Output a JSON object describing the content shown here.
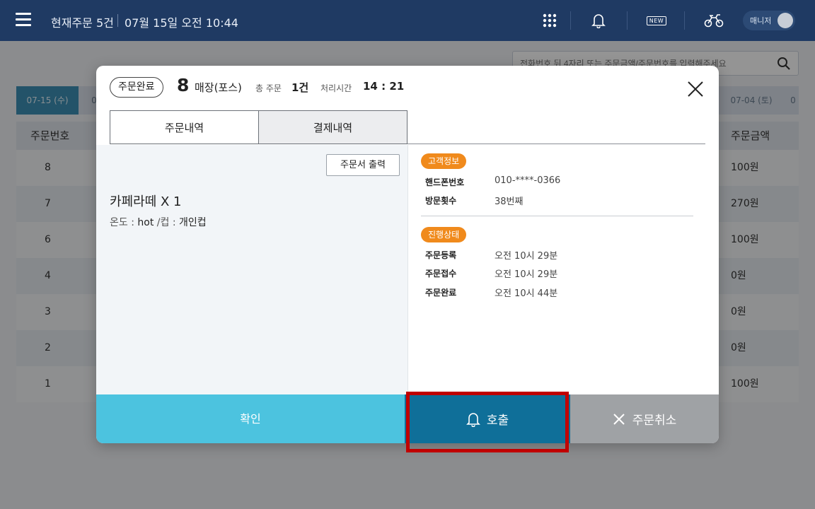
{
  "topbar": {
    "title": "현재주문 5건",
    "datetime": "07월 15일 오전 10:44",
    "new_badge": "NEW",
    "manager_label": "매니저"
  },
  "search": {
    "placeholder": "전화번호 뒤 4자리 또는 주문금액/주문번호를 입력해주세요"
  },
  "date_tabs": {
    "active": "07-15 (수)",
    "left_partial": "0",
    "right": "07-04 (토)",
    "right_partial": "0"
  },
  "table": {
    "headers": {
      "order_number": "주문번호",
      "amount": "주문금액"
    },
    "rows": [
      {
        "num": "8",
        "amount": "100원"
      },
      {
        "num": "7",
        "amount": "270원"
      },
      {
        "num": "6",
        "amount": "100원"
      },
      {
        "num": "4",
        "amount": "0원"
      },
      {
        "num": "3",
        "amount": "0원"
      },
      {
        "num": "2",
        "amount": "0원"
      },
      {
        "num": "1",
        "amount": "100원"
      }
    ]
  },
  "modal": {
    "status": "주문완료",
    "order_number": "8",
    "order_type": "매장(포스)",
    "total_label": "총 주문",
    "total_value": "1건",
    "time_label": "처리시간",
    "time_value": "14 : 21",
    "tabs": {
      "order": "주문내역",
      "payment": "결제내역"
    },
    "print_button": "주문서 출력",
    "item": {
      "name": "카페라떼  X 1",
      "opt_temp_label": "온도 : ",
      "opt_temp_value": "hot",
      "opt_cup_label": " /컵 : ",
      "opt_cup_value": "개인컵"
    },
    "customer": {
      "badge": "고객정보",
      "phone_label": "핸드폰번호",
      "phone_value": "010-****-0366",
      "visits_label": "방문횟수",
      "visits_value": "38번째"
    },
    "progress": {
      "badge": "진행상태",
      "registered_label": "주문등록",
      "registered_value": "오전 10시 29분",
      "accepted_label": "주문접수",
      "accepted_value": "오전 10시 29분",
      "completed_label": "주문완료",
      "completed_value": "오전 10시 44분"
    },
    "footer": {
      "confirm": "확인",
      "call": "호출",
      "cancel": "주문취소"
    }
  },
  "colors": {
    "topbar": "#1f3a63",
    "confirm_button": "#4cc3df",
    "call_button": "#0f6f99",
    "cancel_button": "#9fa2a5",
    "badge": "#f08a1c",
    "highlight": "#c00000"
  }
}
